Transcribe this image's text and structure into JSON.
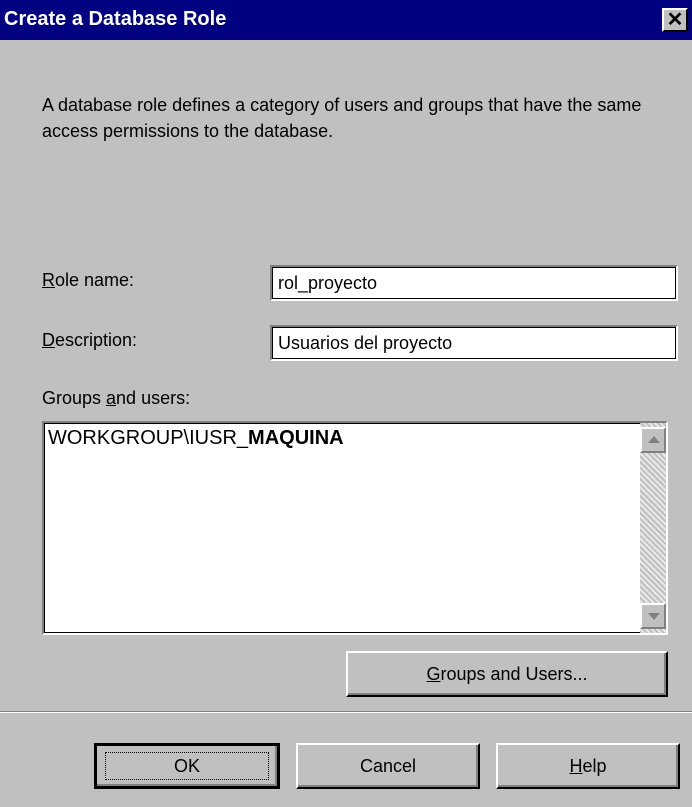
{
  "window": {
    "title": "Create a Database Role",
    "close_glyph": "✕"
  },
  "intro_text": "A database role defines a category of users and groups that have the same access permissions to the database.",
  "fields": {
    "role_name": {
      "label_mnemonic": "R",
      "label_rest": "ole name:",
      "value": "rol_proyecto"
    },
    "description": {
      "label_mnemonic": "D",
      "label_rest": "escription:",
      "value": "Usuarios del proyecto"
    }
  },
  "groups_users": {
    "label_before": "Groups ",
    "label_mnemonic": "a",
    "label_after": "nd users:",
    "items": [
      {
        "prefix": "WORKGROUP\\IUSR_",
        "bold": "MAQUINA"
      }
    ]
  },
  "buttons": {
    "groups_users": {
      "mnemonic": "G",
      "rest": "roups and Users..."
    },
    "ok": "OK",
    "cancel": "Cancel",
    "help": {
      "mnemonic": "H",
      "rest": "elp"
    }
  }
}
